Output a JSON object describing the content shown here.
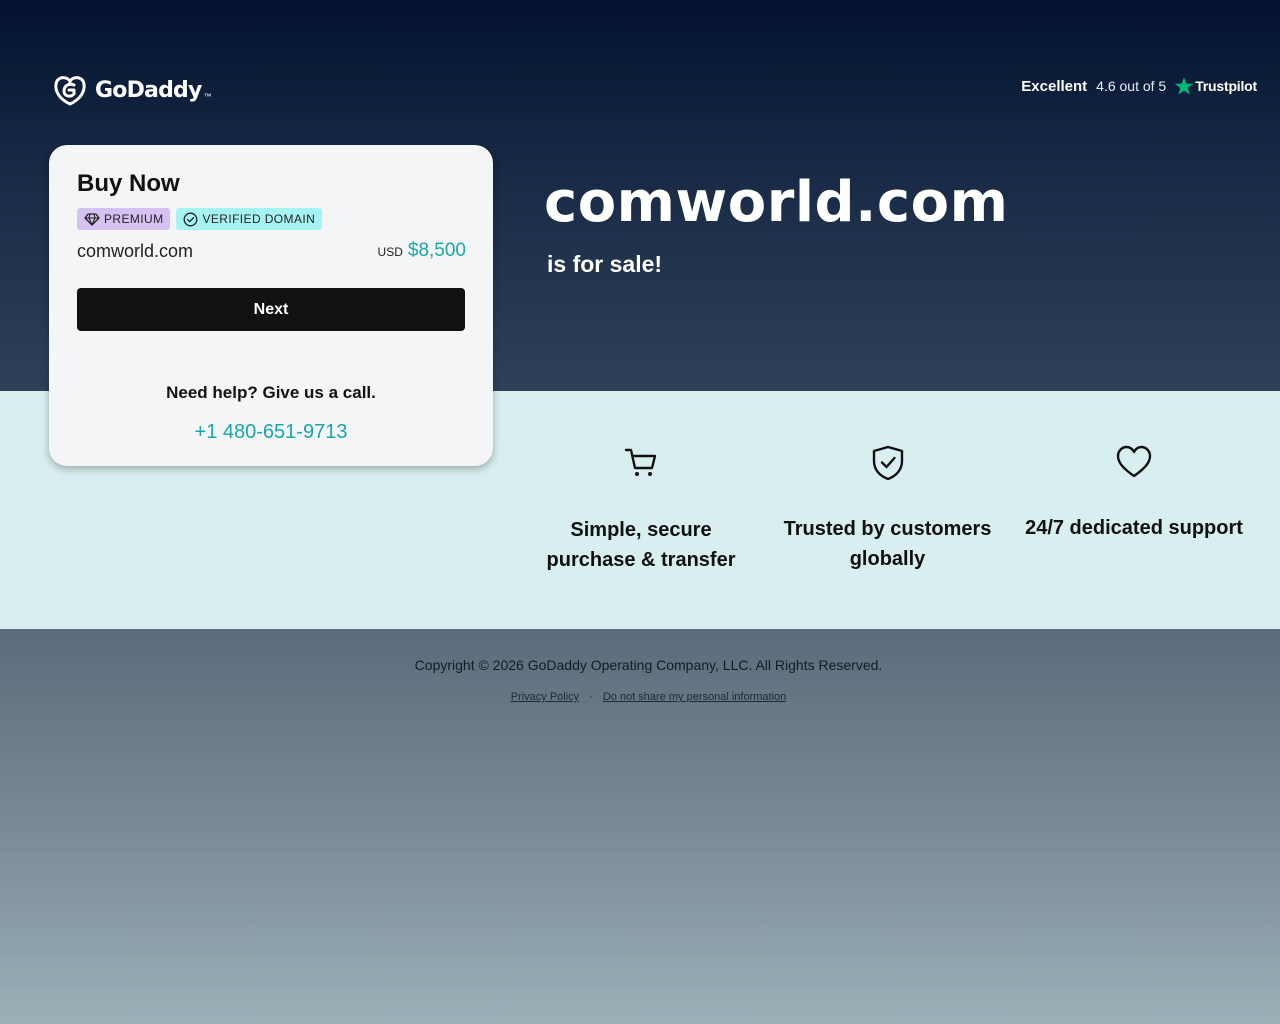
{
  "brand": {
    "name": "GoDaddy",
    "trademark": "™",
    "logo_icon": "godaddy-logo-mark"
  },
  "trustpilot": {
    "rating_word": "Excellent",
    "score_text": "4.6 out of 5",
    "brand": "Trustpilot",
    "star_icon": "trustpilot-star-icon",
    "star_color": "#00b67a"
  },
  "hero": {
    "domain": "comworld.com",
    "sale_text": "is for sale!"
  },
  "buy_card": {
    "title": "Buy Now",
    "badges": [
      {
        "label": "PREMIUM",
        "icon": "diamond-icon",
        "color": "#d6c2f2"
      },
      {
        "label": "VERIFIED DOMAIN",
        "icon": "check-circle-icon",
        "color": "#a6f3f3"
      }
    ],
    "domain": "comworld.com",
    "currency": "USD",
    "price": "$8,500",
    "next_label": "Next",
    "help_text": "Need help? Give us a call.",
    "phone": "+1 480-651-9713"
  },
  "features": [
    {
      "icon": "cart-icon",
      "label": "Simple, secure purchase & transfer"
    },
    {
      "icon": "shield-check-icon",
      "label": "Trusted by customers globally"
    },
    {
      "icon": "heart-icon",
      "label": "24/7 dedicated support"
    }
  ],
  "footer": {
    "copyright": "Copyright © 2026 GoDaddy Operating Company, LLC. All Rights Reserved.",
    "links": [
      "Privacy Policy",
      "Do not share my personal information"
    ],
    "separator": "·"
  },
  "colors": {
    "accent_teal": "#19a7a8",
    "hero_top": "#03132f",
    "hero_bottom": "#2f4159",
    "features_bg": "#d8eeef",
    "button_bg": "#111111"
  }
}
